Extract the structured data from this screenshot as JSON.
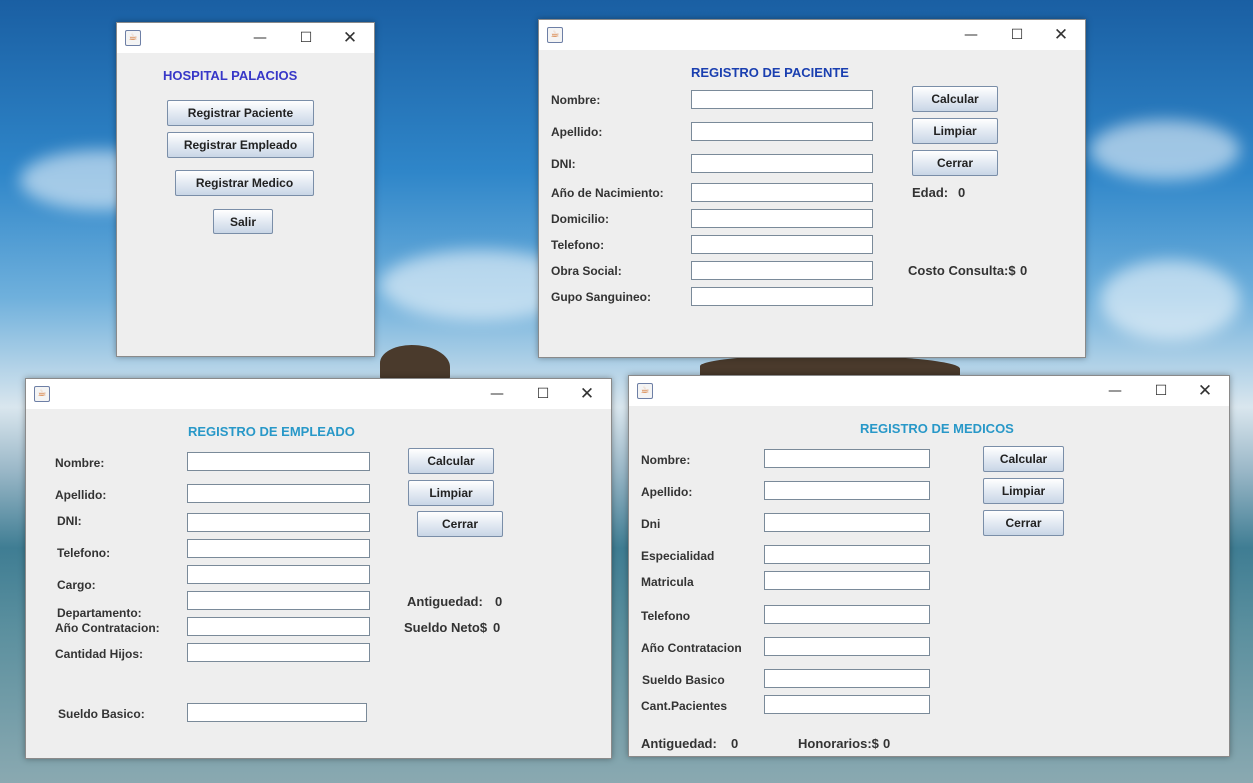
{
  "colors": {
    "heading_dark_blue": "#3737c8",
    "heading_blue": "#1a3fb0",
    "heading_teal": "#2898c8"
  },
  "icons": {
    "app": "java-icon",
    "minimize": "minimize-icon",
    "maximize": "maximize-icon",
    "close": "close-icon"
  },
  "hospital": {
    "title": "HOSPITAL PALACIOS",
    "registrar_paciente": "Registrar Paciente",
    "registrar_empleado": "Registrar Empleado",
    "registrar_medico": "Registrar Medico",
    "salir": "Salir"
  },
  "paciente": {
    "title": "REGISTRO DE PACIENTE",
    "labels": {
      "nombre": "Nombre:",
      "apellido": "Apellido:",
      "dni": "DNI:",
      "anio_nacimiento": "Año de Nacimiento:",
      "domicilio": "Domicilio:",
      "telefono": "Telefono:",
      "obra_social": "Obra Social:",
      "grupo_sanguineo": "Gupo Sanguineo:"
    },
    "buttons": {
      "calcular": "Calcular",
      "limpiar": "Limpiar",
      "cerrar": "Cerrar"
    },
    "edad_label": "Edad:",
    "edad_value": "0",
    "costo_label": "Costo Consulta:$",
    "costo_value": "0"
  },
  "empleado": {
    "title": "REGISTRO DE EMPLEADO",
    "labels": {
      "nombre": "Nombre:",
      "apellido": "Apellido:",
      "dni": "DNI:",
      "telefono": "Telefono:",
      "cargo": "Cargo:",
      "departamento": "Departamento:",
      "anio_contratacion": "Año Contratacion:",
      "cantidad_hijos": "Cantidad Hijos:",
      "sueldo_basico": "Sueldo Basico:"
    },
    "buttons": {
      "calcular": "Calcular",
      "limpiar": "Limpiar",
      "cerrar": "Cerrar"
    },
    "antiguedad_label": "Antiguedad:",
    "antiguedad_value": "0",
    "sueldo_neto_label": "Sueldo Neto$",
    "sueldo_neto_value": "0"
  },
  "medicos": {
    "title": "REGISTRO DE MEDICOS",
    "labels": {
      "nombre": "Nombre:",
      "apellido": "Apellido:",
      "dni": "Dni",
      "especialidad": "Especialidad",
      "matricula": "Matricula",
      "telefono": "Telefono",
      "anio_contratacion": "Año Contratacion",
      "sueldo_basico": "Sueldo Basico",
      "cant_pacientes": "Cant.Pacientes"
    },
    "buttons": {
      "calcular": "Calcular",
      "limpiar": "Limpiar",
      "cerrar": "Cerrar"
    },
    "antiguedad_label": "Antiguedad:",
    "antiguedad_value": "0",
    "honorarios_label": "Honorarios:$",
    "honorarios_value": "0"
  }
}
